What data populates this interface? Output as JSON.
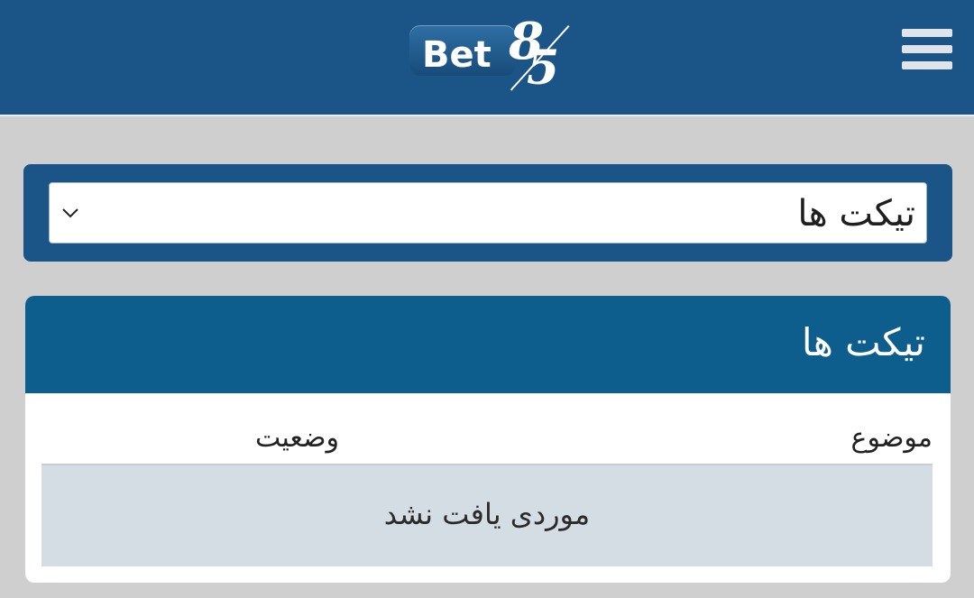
{
  "header": {
    "logo": {
      "word": "Bet",
      "digit_top": "8",
      "digit_bottom": "5"
    },
    "menu_icon": "hamburger-menu-icon",
    "background_color": "#1b5587"
  },
  "selector": {
    "selected_value": "تیکت ها",
    "dropdown_icon": "chevron-down-icon"
  },
  "tickets_card": {
    "title": "تیکت ها",
    "columns": {
      "subject": "موضوع",
      "status": "وضعیت"
    },
    "empty_message": "موردی یافت نشد",
    "header_color": "#0d5e8d",
    "empty_row_color": "#d4dde3"
  }
}
